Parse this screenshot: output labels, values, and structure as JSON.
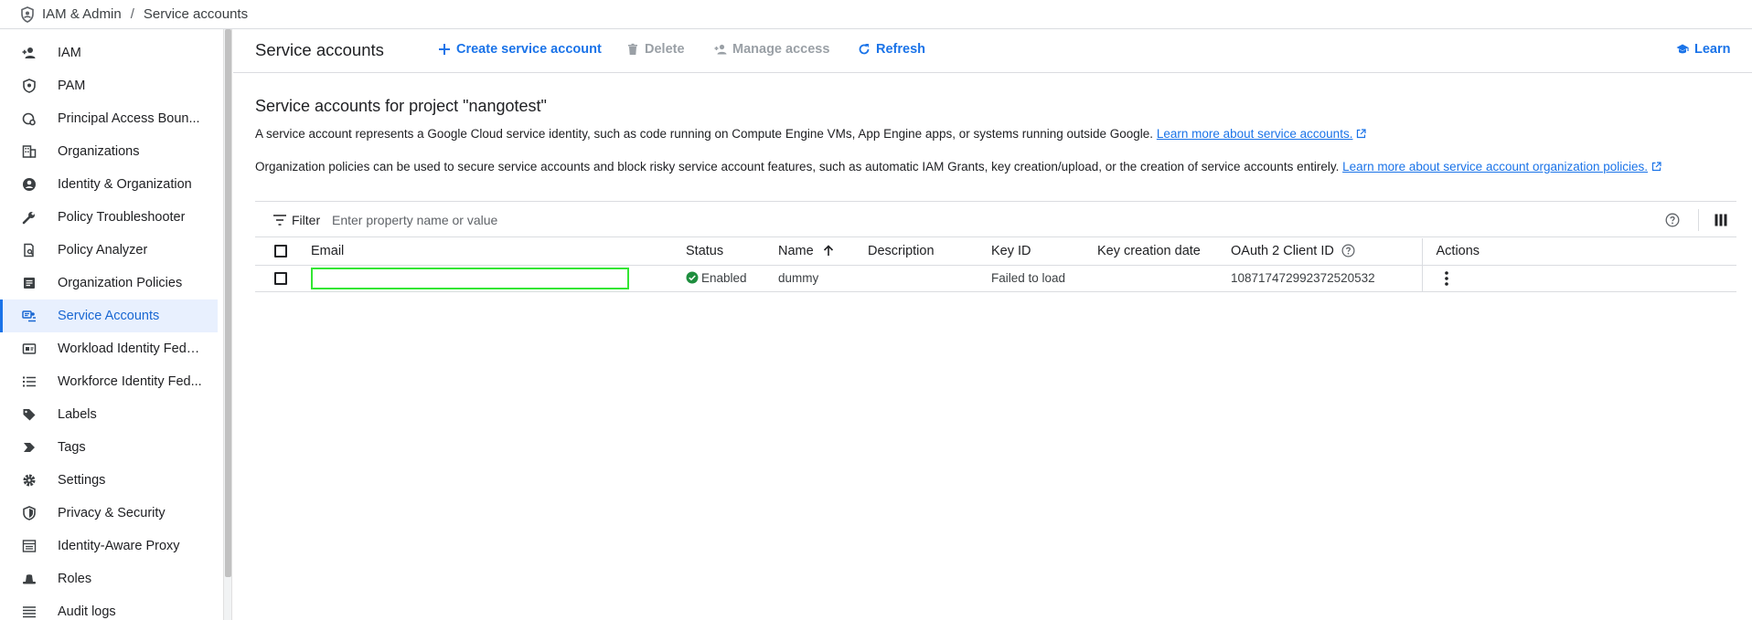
{
  "breadcrumb": {
    "root": "IAM & Admin",
    "separator": "/",
    "current": "Service accounts"
  },
  "sidebar": {
    "items": [
      {
        "label": "IAM",
        "icon": "person-add-icon"
      },
      {
        "label": "PAM",
        "icon": "shield-icon"
      },
      {
        "label": "Principal Access Boun...",
        "icon": "policy-icon"
      },
      {
        "label": "Organizations",
        "icon": "building-icon"
      },
      {
        "label": "Identity & Organization",
        "icon": "person-circle-icon"
      },
      {
        "label": "Policy Troubleshooter",
        "icon": "wrench-icon"
      },
      {
        "label": "Policy Analyzer",
        "icon": "document-search-icon"
      },
      {
        "label": "Organization Policies",
        "icon": "list-box-icon"
      },
      {
        "label": "Service Accounts",
        "icon": "service-account-icon",
        "active": true
      },
      {
        "label": "Workload Identity Fede...",
        "icon": "id-card-icon"
      },
      {
        "label": "Workforce Identity Fed...",
        "icon": "list-icon"
      },
      {
        "label": "Labels",
        "icon": "label-icon"
      },
      {
        "label": "Tags",
        "icon": "tag-arrow-icon"
      },
      {
        "label": "Settings",
        "icon": "gear-icon"
      },
      {
        "label": "Privacy & Security",
        "icon": "shield-lock-icon"
      },
      {
        "label": "Identity-Aware Proxy",
        "icon": "proxy-icon"
      },
      {
        "label": "Roles",
        "icon": "hat-icon"
      },
      {
        "label": "Audit logs",
        "icon": "lines-icon"
      }
    ]
  },
  "toolbar": {
    "title": "Service accounts",
    "create_label": "Create service account",
    "delete_label": "Delete",
    "manage_label": "Manage access",
    "refresh_label": "Refresh",
    "learn_label": "Learn"
  },
  "content": {
    "section_title": "Service accounts for project \"nangotest\"",
    "para1": "A service account represents a Google Cloud service identity, such as code running on Compute Engine VMs, App Engine apps, or systems running outside Google.",
    "para1_link": "Learn more about service accounts.",
    "para2": "Organization policies can be used to secure service accounts and block risky service account features, such as automatic IAM Grants, key creation/upload, or the creation of service accounts entirely.",
    "para2_link": "Learn more about service account organization policies."
  },
  "filter": {
    "label": "Filter",
    "placeholder": "Enter property name or value"
  },
  "table": {
    "headers": {
      "email": "Email",
      "status": "Status",
      "name": "Name",
      "description": "Description",
      "key_id": "Key ID",
      "key_creation_date": "Key creation date",
      "oauth_client_id": "OAuth 2 Client ID",
      "actions": "Actions"
    },
    "rows": [
      {
        "email": "",
        "status": "Enabled",
        "name": "dummy",
        "description": "",
        "key_id": "Failed to load",
        "key_creation_date": "",
        "oauth_client_id": "108717472992372520532"
      }
    ]
  },
  "colors": {
    "accent": "#1a73e8",
    "active_bg": "#e8f0fe",
    "enabled_green": "#1e8e3e",
    "highlight_box": "#33e633"
  }
}
